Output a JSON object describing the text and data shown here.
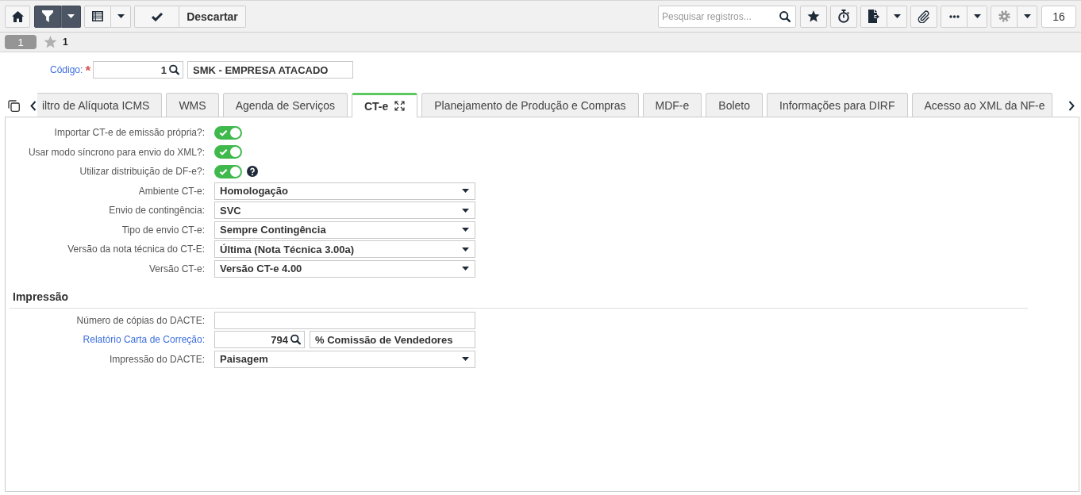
{
  "toolbar": {
    "filter_active": true,
    "discard_label": "Descartar",
    "search": {
      "placeholder": "Pesquisar registros..."
    },
    "counter": "16"
  },
  "record_bar": {
    "record_tab": "1",
    "favorite_count": "1"
  },
  "header": {
    "code_label": "Código:",
    "required_mark": "*",
    "code_value": "1",
    "name_value": "SMK - EMPRESA ATACADO"
  },
  "tabs": [
    {
      "label": "iltro de Alíquota ICMS",
      "selected": false
    },
    {
      "label": "WMS",
      "selected": false
    },
    {
      "label": "Agenda de Serviços",
      "selected": false
    },
    {
      "label": "CT-e",
      "selected": true
    },
    {
      "label": "Planejamento de Produção e Compras",
      "selected": false
    },
    {
      "label": "MDF-e",
      "selected": false
    },
    {
      "label": "Boleto",
      "selected": false
    },
    {
      "label": "Informações para DIRF",
      "selected": false
    },
    {
      "label": "Acesso ao XML da NF-e",
      "selected": false
    }
  ],
  "form": {
    "rows": [
      {
        "kind": "toggle",
        "label": "Importar CT-e de emissão própria?:",
        "on": true
      },
      {
        "kind": "toggle",
        "label": "Usar modo síncrono para envio do XML?:",
        "on": true
      },
      {
        "kind": "toggle",
        "label": "Utilizar distribuição de DF-e?:",
        "on": true,
        "help": true
      },
      {
        "kind": "select",
        "label": "Ambiente CT-e:",
        "value": "Homologação"
      },
      {
        "kind": "select",
        "label": "Envio de contingência:",
        "value": "SVC"
      },
      {
        "kind": "select",
        "label": "Tipo de envio CT-e:",
        "value": "Sempre Contingência"
      },
      {
        "kind": "select",
        "label": "Versão da nota técnica do CT-E:",
        "value": "Última (Nota Técnica 3.00a)"
      },
      {
        "kind": "select",
        "label": "Versão CT-e:",
        "value": "Versão CT-e 4.00"
      }
    ],
    "sections": [
      {
        "title": "Impressão",
        "rows": [
          {
            "kind": "text",
            "label": "Número de cópias do DACTE:"
          },
          {
            "kind": "lookup",
            "label": "Relatório Carta de Correção:",
            "code": "794",
            "name": "% Comissão de Vendedores"
          },
          {
            "kind": "select",
            "label": "Impressão do DACTE:",
            "value": "Paisagem"
          }
        ]
      }
    ]
  }
}
